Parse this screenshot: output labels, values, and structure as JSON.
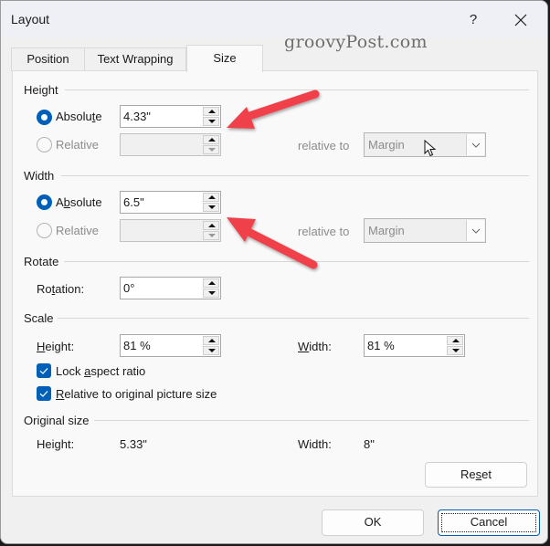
{
  "window": {
    "title": "Layout",
    "help_label": "?",
    "close_icon": "close-icon",
    "watermark": "groovyPost.com"
  },
  "tabs": [
    {
      "label": "Position",
      "active": false
    },
    {
      "label": "Text Wrapping",
      "active": false
    },
    {
      "label": "Size",
      "active": true
    }
  ],
  "height": {
    "group_label": "Height",
    "absolute": {
      "label_pre": "Absolu",
      "label_ul": "t",
      "label_post": "e",
      "checked": true,
      "value": "4.33\""
    },
    "relative": {
      "label": "Relative",
      "checked": false,
      "enabled": false,
      "value": ""
    },
    "relative_to_label": "relative to",
    "relative_to_value": "Margin"
  },
  "width": {
    "group_label": "Width",
    "absolute": {
      "label_pre": "A",
      "label_ul": "b",
      "label_post": "solute",
      "checked": true,
      "value": "6.5\""
    },
    "relative": {
      "label": "Relative",
      "checked": false,
      "enabled": false,
      "value": ""
    },
    "relative_to_label": "relative to",
    "relative_to_value": "Margin"
  },
  "rotate": {
    "group_label": "Rotate",
    "rotation_label_pre": "Ro",
    "rotation_label_ul": "t",
    "rotation_label_post": "ation:",
    "rotation_value": "0°"
  },
  "scale": {
    "group_label": "Scale",
    "height_label_ul": "H",
    "height_label_post": "eight:",
    "height_value": "81 %",
    "width_label_ul": "W",
    "width_label_post": "idth:",
    "width_value": "81 %",
    "lock_aspect": {
      "label_pre": "Lock ",
      "label_ul": "a",
      "label_post": "spect ratio",
      "checked": true
    },
    "relative_original": {
      "label_ul": "R",
      "label_post": "elative to original picture size",
      "checked": true
    }
  },
  "original_size": {
    "group_label": "Original size",
    "height_label": "Height:",
    "height_value": "5.33\"",
    "width_label": "Width:",
    "width_value": "8\""
  },
  "buttons": {
    "reset_pre": "Re",
    "reset_ul": "s",
    "reset_post": "et",
    "ok": "OK",
    "cancel": "Cancel"
  },
  "annotations": {
    "arrow_color": "#f0404a",
    "arrows": [
      "pointing-to-height-absolute",
      "pointing-to-width-absolute"
    ]
  },
  "colors": {
    "accent": "#005fb8"
  }
}
